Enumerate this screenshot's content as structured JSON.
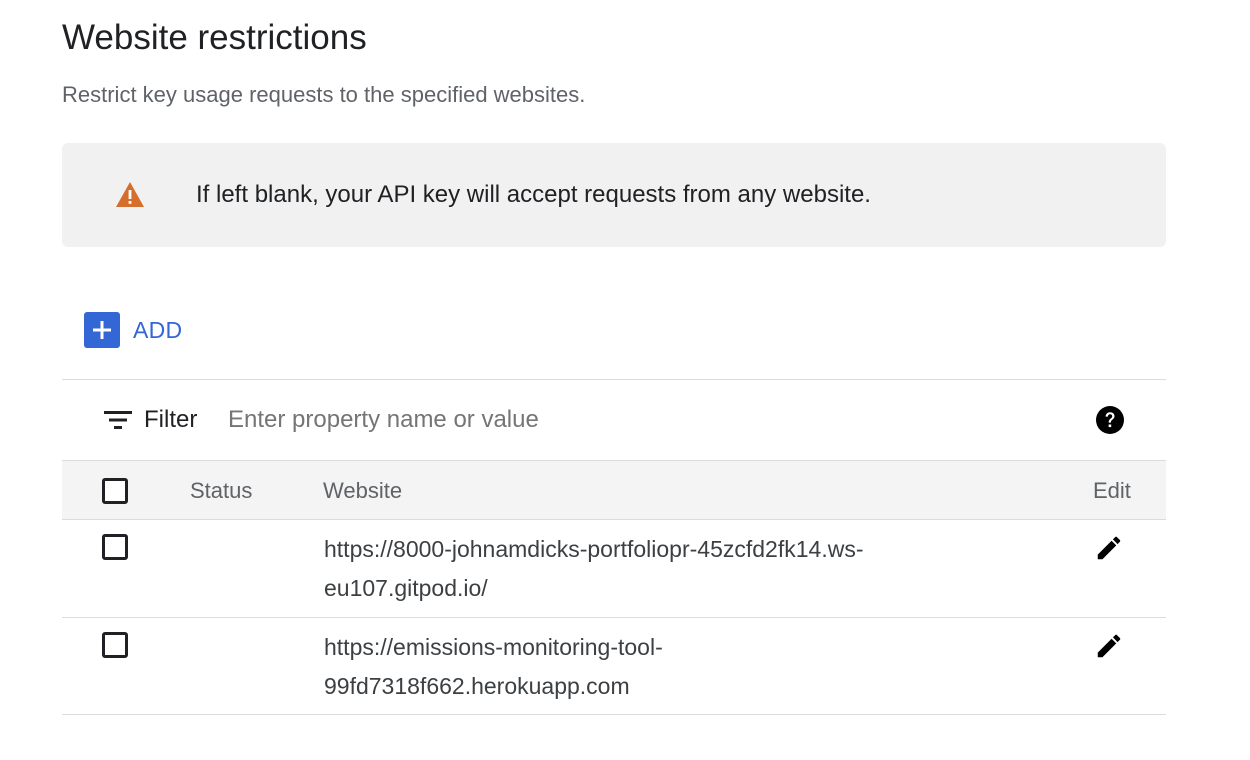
{
  "section": {
    "title": "Website restrictions",
    "subtitle": "Restrict key usage requests to the specified websites."
  },
  "notice": {
    "icon": "warning-icon",
    "icon_color": "#d56e2c",
    "text": "If left blank, your API key will accept requests from any website."
  },
  "add_button": {
    "label": "ADD",
    "icon": "plus-icon",
    "color": "#3367d6"
  },
  "filter": {
    "label": "Filter",
    "placeholder": "Enter property name or value",
    "value": "",
    "help_icon": "help-icon"
  },
  "table": {
    "columns": {
      "status": "Status",
      "website": "Website",
      "edit": "Edit"
    },
    "rows": [
      {
        "status": "",
        "website_line1": "https://8000-johnamdicks-portfoliopr-45zcfd2fk14.ws-",
        "website_line2": "eu107.gitpod.io/"
      },
      {
        "status": "",
        "website_line1": "https://emissions-monitoring-tool-",
        "website_line2": "99fd7318f662.herokuapp.com"
      }
    ]
  }
}
